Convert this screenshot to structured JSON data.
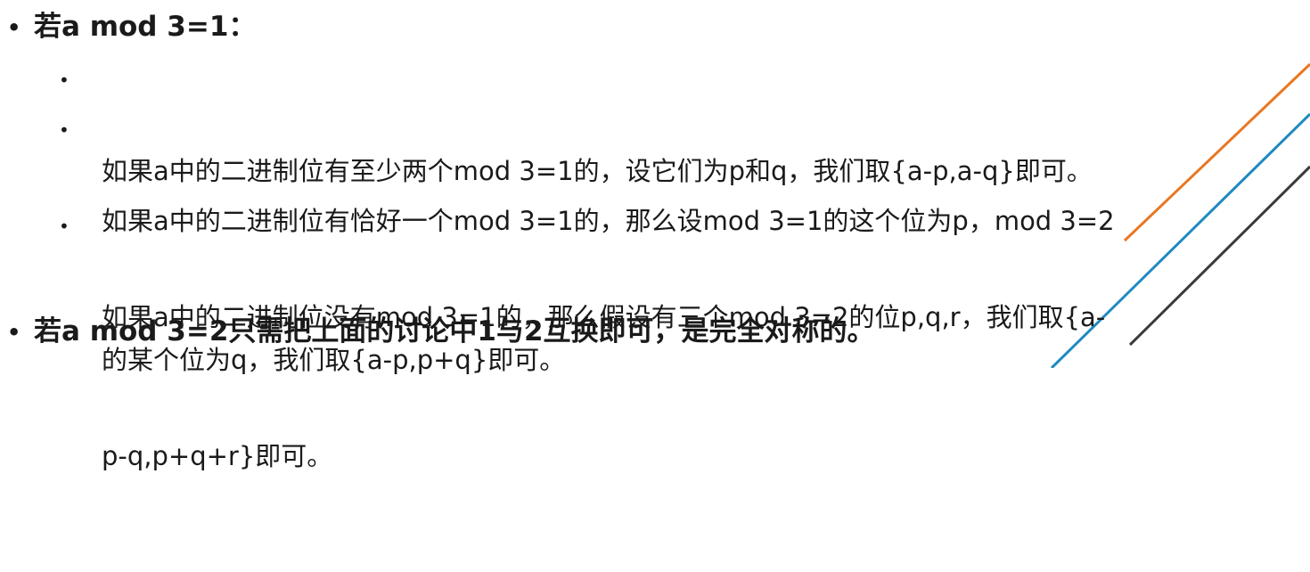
{
  "bullets": {
    "primary": "•",
    "secondary": "•"
  },
  "items": [
    {
      "text": "若a mod 3=1："
    },
    {
      "lines": [
        "如果a中的二进制位有至少两个mod 3=1的，设它们为p和q，我们取{a-p,a-q}即可。"
      ]
    },
    {
      "lines": [
        "如果a中的二进制位有恰好一个mod 3=1的，那么设mod 3=1的这个位为p，mod 3=2",
        "的某个位为q，我们取{a-p,p+q}即可。"
      ]
    },
    {
      "lines": [
        "如果a中的二进制位没有mod 3=1的，那么假设有三个mod 3=2的位p,q,r，我们取{a-",
        "p-q,p+q+r}即可。"
      ]
    },
    {
      "text": "若a mod 3=2只需把上面的讨论中1与2互换即可，是完全对称的。"
    }
  ],
  "colors": {
    "stripe_orange": "#e87722",
    "stripe_blue": "#1f8ac0",
    "stripe_dark": "#3a3a3a"
  }
}
